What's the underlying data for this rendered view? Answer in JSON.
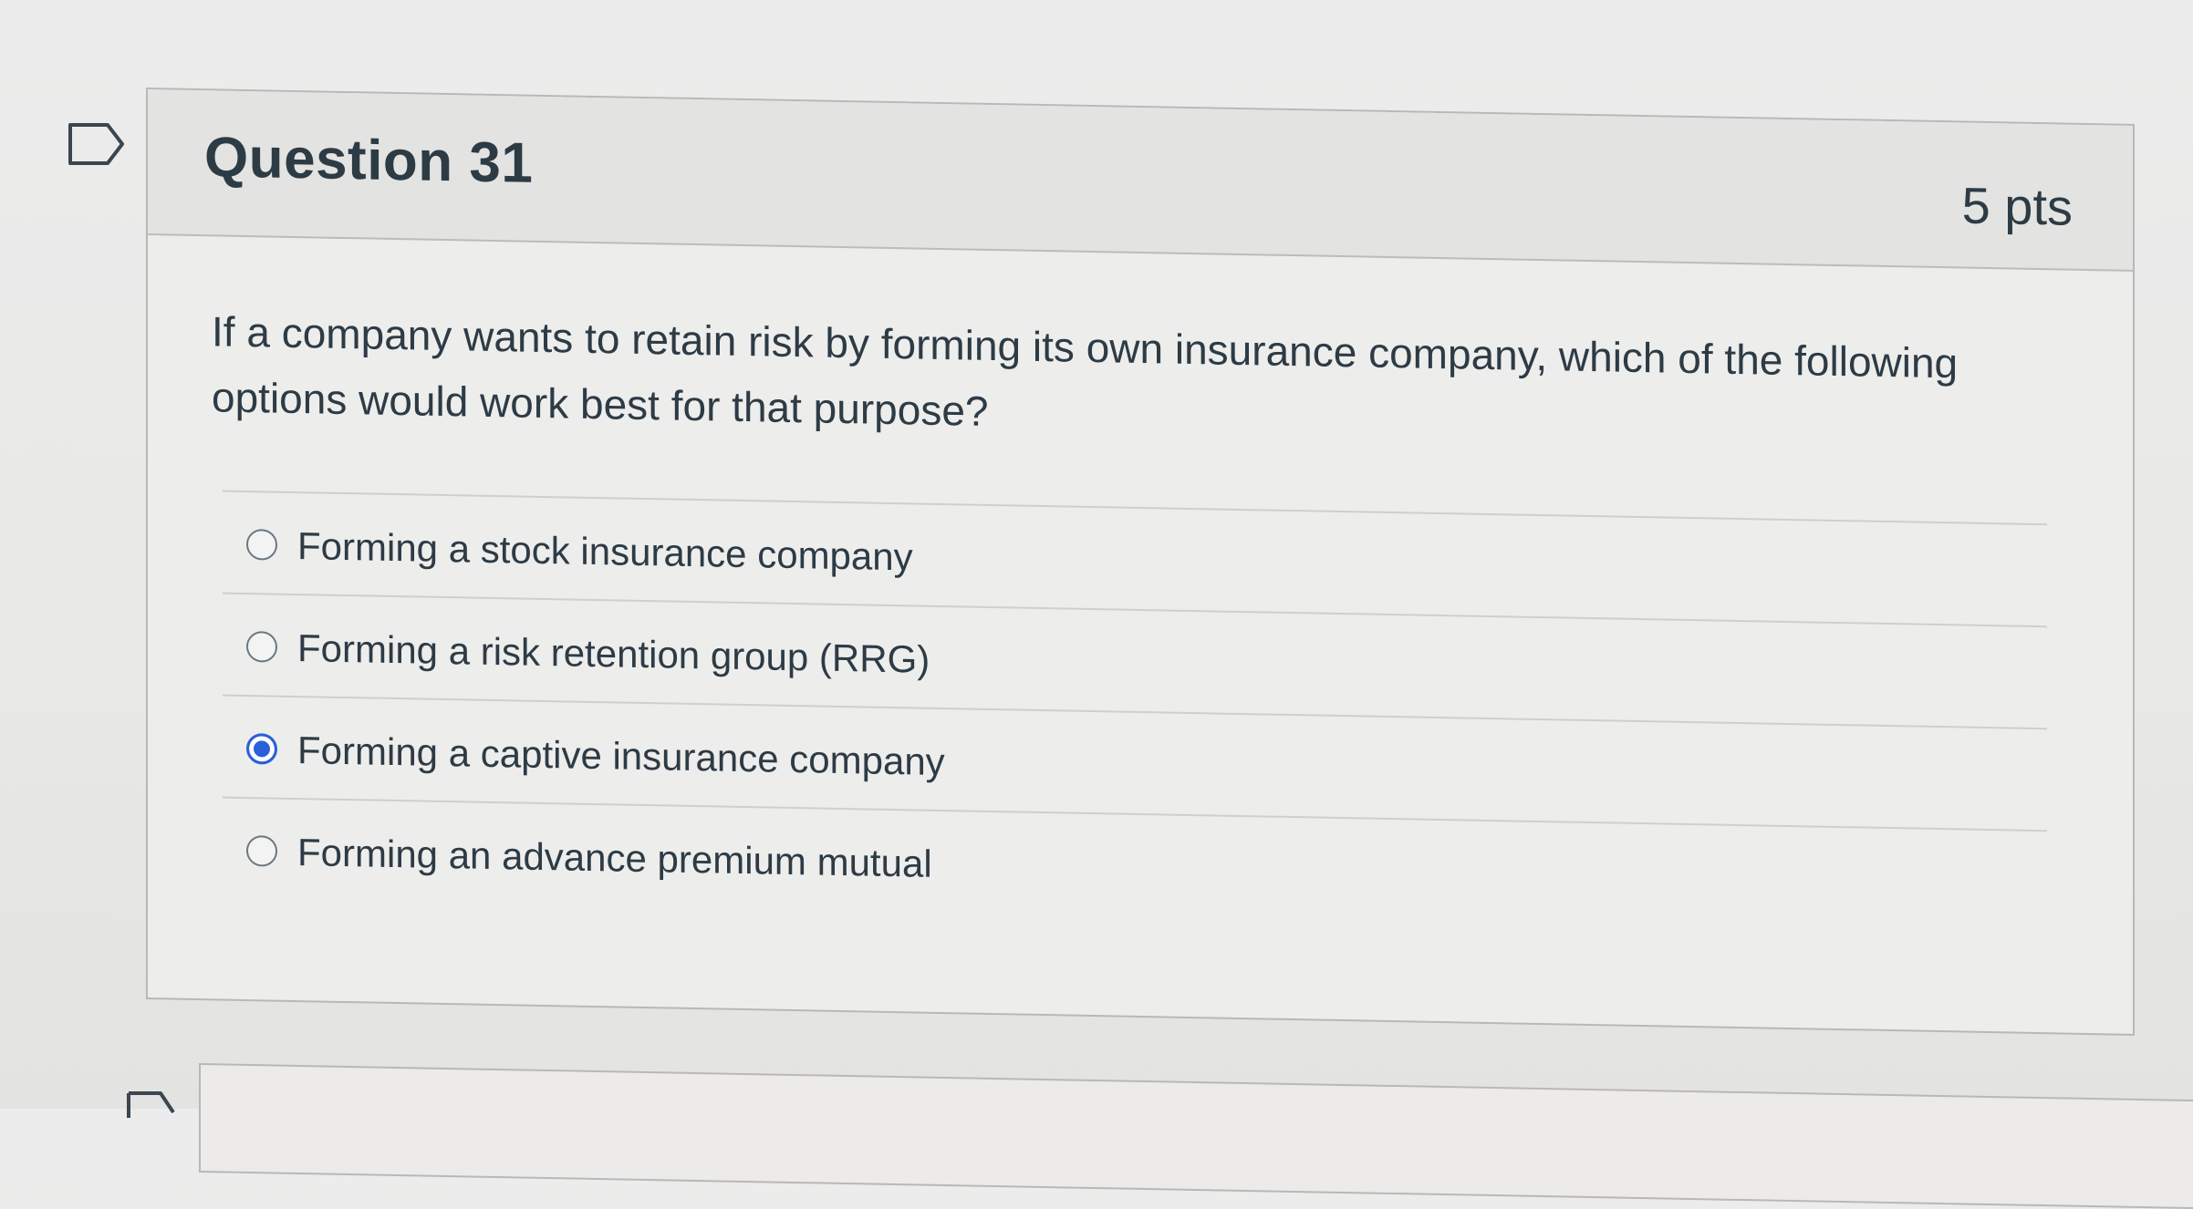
{
  "question": {
    "title": "Question 31",
    "points": "5 pts",
    "text": "If a company wants to retain risk by forming its own insurance company, which of the following options would work best for that purpose?",
    "answers": [
      {
        "label": "Forming a stock insurance company",
        "selected": false
      },
      {
        "label": "Forming a risk retention group (RRG)",
        "selected": false
      },
      {
        "label": "Forming a captive insurance company",
        "selected": true
      },
      {
        "label": "Forming an advance premium mutual",
        "selected": false
      }
    ]
  },
  "colors": {
    "accent": "#2b5fd9",
    "text": "#2d3b45",
    "background": "#ececec"
  },
  "icons": {
    "flag": "flag-question-icon"
  }
}
